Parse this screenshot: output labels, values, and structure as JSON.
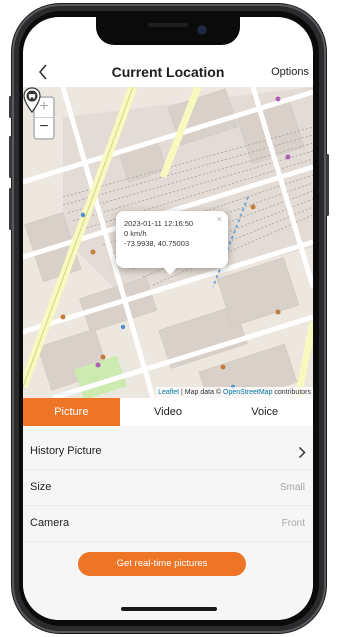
{
  "header": {
    "title": "Current Location",
    "options_label": "Options"
  },
  "map": {
    "zoom_in_label": "+",
    "zoom_out_label": "−",
    "attribution": {
      "leaflet": "Leaflet",
      "separator": " | Map data © ",
      "osm": "OpenStreetMap",
      "suffix": " contributors"
    },
    "popup": {
      "timestamp": "2023-01-11 12:16:50",
      "speed": "0 km/h",
      "coordinates": "-73.9938, 40.75003",
      "close_label": "×"
    }
  },
  "tabs": [
    {
      "label": "Picture",
      "active": true
    },
    {
      "label": "Video",
      "active": false
    },
    {
      "label": "Voice",
      "active": false
    }
  ],
  "settings": {
    "history_label": "History Picture",
    "size_label": "Size",
    "size_value": "Small",
    "camera_label": "Camera",
    "camera_value": "Front"
  },
  "actions": {
    "realtime_button": "Get real-time pictures"
  },
  "colors": {
    "accent": "#ee7426",
    "list_background": "#f6f6f6"
  }
}
